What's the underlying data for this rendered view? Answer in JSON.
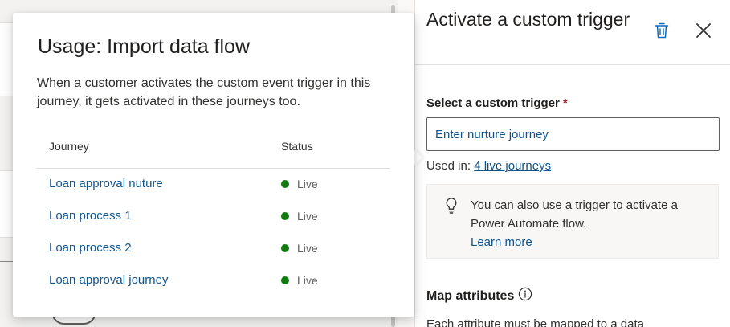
{
  "popover": {
    "title": "Usage: Import data flow",
    "description": "When a customer activates the custom event trigger in this journey, it gets activated in these journeys too.",
    "columns": {
      "journey": "Journey",
      "status": "Status"
    },
    "rows": [
      {
        "journey": "Loan approval nuture",
        "status": "Live"
      },
      {
        "journey": "Loan process 1",
        "status": "Live"
      },
      {
        "journey": "Loan process 2",
        "status": "Live"
      },
      {
        "journey": "Loan approval journey",
        "status": "Live"
      }
    ],
    "status_color": "#107c10"
  },
  "panel": {
    "title": "Activate a custom trigger",
    "delete_icon": "trash-icon",
    "close_icon": "close-icon",
    "field_label": "Select a custom trigger",
    "required_marker": "*",
    "input_placeholder": "Enter nurture journey",
    "used_in_prefix": "Used in:",
    "used_in_link": "4 live journeys",
    "info": {
      "icon": "lightbulb-icon",
      "text": "You can also use a trigger to activate a Power Automate flow.",
      "link": "Learn more"
    },
    "map_title": "Map attributes",
    "map_info_icon": "info-icon",
    "map_description": "Each attribute must be mapped to a data"
  },
  "colors": {
    "accent": "#0f548c",
    "brand_icon": "#0f6cbd"
  }
}
